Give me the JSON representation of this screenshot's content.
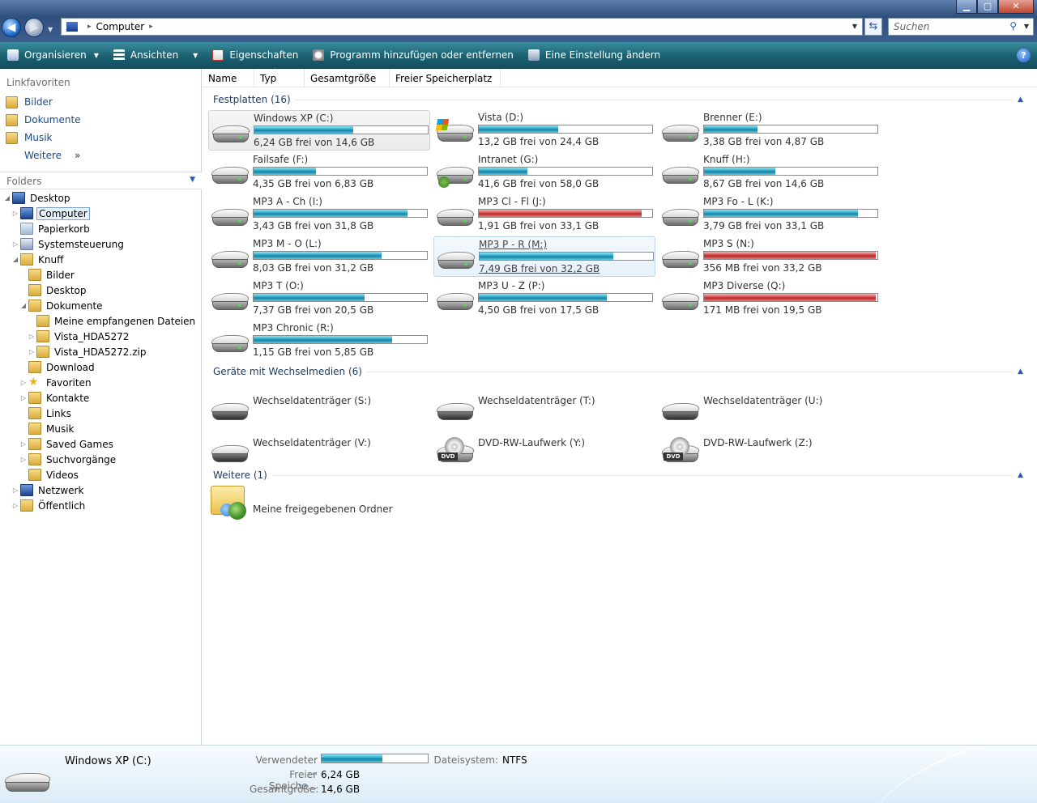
{
  "window": {
    "minimize": "▁",
    "maximize": "▢",
    "close": "✕"
  },
  "address": {
    "crumb": "Computer"
  },
  "search": {
    "placeholder": "Suchen"
  },
  "toolbar": {
    "organize": "Organisieren",
    "views": "Ansichten",
    "properties": "Eigenschaften",
    "add_remove": "Programm hinzufügen oder entfernen",
    "change_setting": "Eine Einstellung ändern",
    "help": "?"
  },
  "linkfavs": {
    "title": "Linkfavoriten",
    "items": [
      "Bilder",
      "Dokumente",
      "Musik"
    ],
    "more": "Weitere",
    "more_chev": "»"
  },
  "folders": {
    "title": "Folders"
  },
  "tree": [
    {
      "label": "Desktop",
      "level": 0,
      "exp": "◢",
      "icon": "pc"
    },
    {
      "label": "Computer",
      "level": 1,
      "exp": "▷",
      "icon": "pc",
      "sel": true
    },
    {
      "label": "Papierkorb",
      "level": 1,
      "exp": "",
      "icon": "bin"
    },
    {
      "label": "Systemsteuerung",
      "level": 1,
      "exp": "▷",
      "icon": "gear"
    },
    {
      "label": "Knuff",
      "level": 1,
      "exp": "◢",
      "icon": "folder"
    },
    {
      "label": "Bilder",
      "level": 2,
      "exp": "",
      "icon": "folder"
    },
    {
      "label": "Desktop",
      "level": 2,
      "exp": "",
      "icon": "folder"
    },
    {
      "label": "Dokumente",
      "level": 2,
      "exp": "◢",
      "icon": "folder"
    },
    {
      "label": "Meine empfangenen Dateien",
      "level": 3,
      "exp": "",
      "icon": "folder"
    },
    {
      "label": "Vista_HDA5272",
      "level": 3,
      "exp": "▷",
      "icon": "folder"
    },
    {
      "label": "Vista_HDA5272.zip",
      "level": 3,
      "exp": "▷",
      "icon": "folder"
    },
    {
      "label": "Download",
      "level": 2,
      "exp": "",
      "icon": "folder"
    },
    {
      "label": "Favoriten",
      "level": 2,
      "exp": "▷",
      "icon": "star"
    },
    {
      "label": "Kontakte",
      "level": 2,
      "exp": "▷",
      "icon": "folder"
    },
    {
      "label": "Links",
      "level": 2,
      "exp": "",
      "icon": "folder"
    },
    {
      "label": "Musik",
      "level": 2,
      "exp": "",
      "icon": "folder"
    },
    {
      "label": "Saved Games",
      "level": 2,
      "exp": "▷",
      "icon": "folder"
    },
    {
      "label": "Suchvorgänge",
      "level": 2,
      "exp": "▷",
      "icon": "folder"
    },
    {
      "label": "Videos",
      "level": 2,
      "exp": "",
      "icon": "folder"
    },
    {
      "label": "Netzwerk",
      "level": 1,
      "exp": "▷",
      "icon": "pc"
    },
    {
      "label": "Öffentlich",
      "level": 1,
      "exp": "▷",
      "icon": "folder"
    }
  ],
  "columns": [
    "Name",
    "Typ",
    "Gesamtgröße",
    "Freier Speicherplatz"
  ],
  "groups": {
    "hdd": "Festplatten (16)",
    "removable": "Geräte mit Wechselmedien (6)",
    "other": "Weitere (1)",
    "collapse": "▲"
  },
  "drives": [
    {
      "name": "Windows XP (C:)",
      "free": "6,24 GB frei von 14,6 GB",
      "used": 0.57,
      "icon": "hdd",
      "state": "selected"
    },
    {
      "name": "Vista (D:)",
      "free": "13,2 GB frei von 24,4 GB",
      "used": 0.46,
      "icon": "win",
      "state": ""
    },
    {
      "name": "Brenner (E:)",
      "free": "3,38 GB frei von 4,87 GB",
      "used": 0.31,
      "icon": "hdd",
      "state": ""
    },
    {
      "name": "Failsafe (F:)",
      "free": "4,35 GB frei von 6,83 GB",
      "used": 0.36,
      "icon": "hdd",
      "state": ""
    },
    {
      "name": "Intranet (G:)",
      "free": "41,6 GB frei von 58,0 GB",
      "used": 0.28,
      "icon": "net",
      "state": ""
    },
    {
      "name": "Knuff (H:)",
      "free": "8,67 GB frei von 14,6 GB",
      "used": 0.41,
      "icon": "hdd",
      "state": ""
    },
    {
      "name": "MP3 A - Ch (I:)",
      "free": "3,43 GB frei von 31,8 GB",
      "used": 0.89,
      "icon": "hdd",
      "state": ""
    },
    {
      "name": "MP3 Cl - Fl (J:)",
      "free": "1,91 GB frei von 33,1 GB",
      "used": 0.94,
      "icon": "hdd",
      "state": "",
      "red": true
    },
    {
      "name": "MP3 Fo - L (K:)",
      "free": "3,79 GB frei von 33,1 GB",
      "used": 0.89,
      "icon": "hdd",
      "state": ""
    },
    {
      "name": "MP3 M - O (L:)",
      "free": "8,03 GB frei von 31,2 GB",
      "used": 0.74,
      "icon": "hdd",
      "state": ""
    },
    {
      "name": "MP3 P - R (M:)",
      "free": "7,49 GB frei von 32,2 GB",
      "used": 0.77,
      "icon": "hdd",
      "state": "hover"
    },
    {
      "name": "MP3 S (N:)",
      "free": "356 MB frei von 33,2 GB",
      "used": 0.99,
      "icon": "hdd",
      "state": "",
      "red": true
    },
    {
      "name": "MP3 T (O:)",
      "free": "7,37 GB frei von 20,5 GB",
      "used": 0.64,
      "icon": "hdd",
      "state": ""
    },
    {
      "name": "MP3 U - Z (P:)",
      "free": "4,50 GB frei von 17,5 GB",
      "used": 0.74,
      "icon": "hdd",
      "state": ""
    },
    {
      "name": "MP3 Diverse (Q:)",
      "free": "171 MB frei von 19,5 GB",
      "used": 0.99,
      "icon": "hdd",
      "state": "",
      "red": true
    },
    {
      "name": "MP3 Chronic (R:)",
      "free": "1,15 GB frei von 5,85 GB",
      "used": 0.8,
      "icon": "hdd",
      "state": ""
    }
  ],
  "removable": [
    {
      "name": "Wechseldatenträger (S:)",
      "icon": "rem"
    },
    {
      "name": "Wechseldatenträger (T:)",
      "icon": "rem"
    },
    {
      "name": "Wechseldatenträger (U:)",
      "icon": "rem"
    },
    {
      "name": "Wechseldatenträger (V:)",
      "icon": "rem"
    },
    {
      "name": "DVD-RW-Laufwerk (Y:)",
      "icon": "dvd",
      "tag": "DVD"
    },
    {
      "name": "DVD-RW-Laufwerk (Z:)",
      "icon": "dvd",
      "tag": "DVD"
    }
  ],
  "other": {
    "name": "Meine freigegebenen Ordner"
  },
  "details": {
    "name": "Windows XP (C:)",
    "used_label": "Verwendeter ...",
    "used_fraction": 0.57,
    "free_label": "Freier Speiche...",
    "free_value": "6,24 GB",
    "total_label": "Gesamtgröße:",
    "total_value": "14,6 GB",
    "fs_label": "Dateisystem:",
    "fs_value": "NTFS"
  }
}
